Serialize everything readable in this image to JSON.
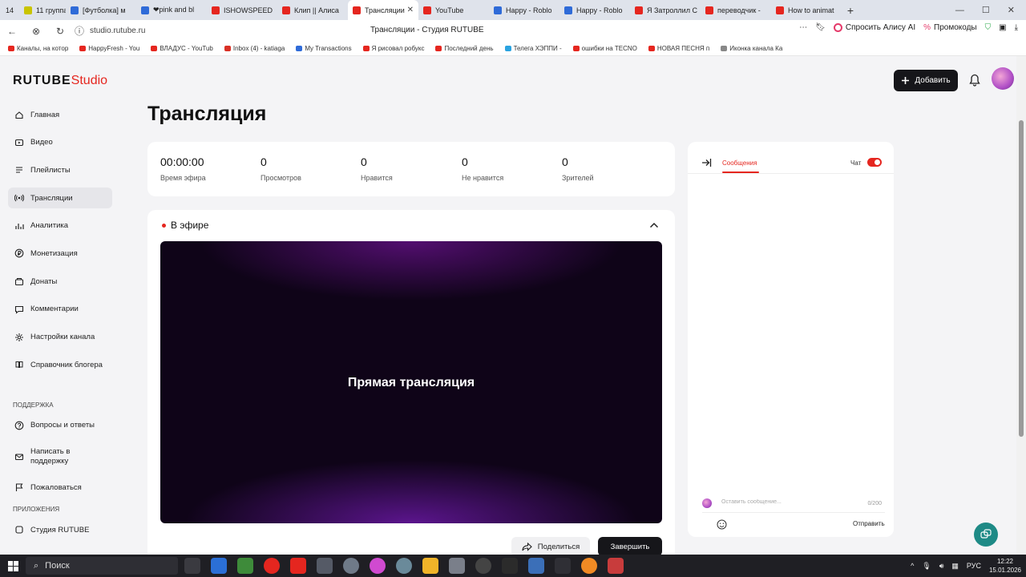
{
  "browser": {
    "tabs": [
      {
        "label": "14",
        "color": "#ffffff",
        "kind": "first"
      },
      {
        "label": "11 группа 1",
        "color": "#c9c400",
        "kind": "group"
      },
      {
        "label": "[Футболка] м",
        "color": "#2f6bd8"
      },
      {
        "label": "❤pink and bl",
        "color": "#2f6bd8"
      },
      {
        "label": "ISHOWSPEED",
        "color": "#e5261f"
      },
      {
        "label": "Клип || Алиса",
        "color": "#e5261f"
      },
      {
        "label": "Трансляции",
        "color": "#e5261f",
        "active": true,
        "close": "✕"
      },
      {
        "label": "YouTube",
        "color": "#e5261f"
      },
      {
        "label": "Happy - Roblo",
        "color": "#2f6bd8"
      },
      {
        "label": "Happy - Roblo",
        "color": "#2f6bd8"
      },
      {
        "label": "Я Затроллил С",
        "color": "#e5261f"
      },
      {
        "label": "переводчик -",
        "color": "#e5261f"
      },
      {
        "label": "How to animat",
        "color": "#e5261f"
      }
    ],
    "url": "studio.rutube.ru",
    "page_title": "Трансляции - Студия RUTUBE",
    "alisa_label": "Спросить Алису AI",
    "promo_label": "Промокоды",
    "bookmarks": [
      {
        "label": "Каналы, на котор",
        "color": "#e5261f"
      },
      {
        "label": "HappyFresh - You",
        "color": "#e5261f"
      },
      {
        "label": "ВЛАДУС - YouTub",
        "color": "#e5261f"
      },
      {
        "label": "Inbox (4) - katiaga",
        "color": "#d93025"
      },
      {
        "label": "My Transactions",
        "color": "#2f6bd8"
      },
      {
        "label": "Я рисовал робукс",
        "color": "#e5261f"
      },
      {
        "label": "Последний день",
        "color": "#e5261f"
      },
      {
        "label": "Телега ХЭППИ -",
        "color": "#2aa3e0"
      },
      {
        "label": "ошибки на TECNO",
        "color": "#e5261f"
      },
      {
        "label": "НОВАЯ ПЕСНЯ п",
        "color": "#e5261f"
      },
      {
        "label": "Иконка канала Ка",
        "color": "#888888"
      }
    ]
  },
  "app": {
    "logo_main": "RUTUBE",
    "logo_studio": "Studio",
    "add_label": "Добавить",
    "page_title": "Трансляция",
    "sidebar": {
      "items": [
        {
          "label": "Главная",
          "icon": "home-icon"
        },
        {
          "label": "Видео",
          "icon": "video-icon"
        },
        {
          "label": "Плейлисты",
          "icon": "playlist-icon"
        },
        {
          "label": "Трансляции",
          "icon": "broadcast-icon",
          "active": true
        },
        {
          "label": "Аналитика",
          "icon": "analytics-icon"
        },
        {
          "label": "Монетизация",
          "icon": "monetization-icon"
        },
        {
          "label": "Донаты",
          "icon": "donate-icon"
        },
        {
          "label": "Комментарии",
          "icon": "comments-icon"
        },
        {
          "label": "Настройки канала",
          "icon": "gear-icon"
        },
        {
          "label": "Справочник блогера",
          "icon": "book-icon"
        }
      ],
      "support_heading": "ПОДДЕРЖКА",
      "support_items": [
        {
          "label": "Вопросы и ответы",
          "icon": "question-icon"
        },
        {
          "label": "Написать в поддержку",
          "icon": "mail-icon"
        },
        {
          "label": "Пожаловаться",
          "icon": "flag-icon"
        }
      ],
      "apps_heading": "ПРИЛОЖЕНИЯ",
      "apps_items": [
        {
          "label": "Студия RUTUBE",
          "icon": "app-icon"
        }
      ]
    },
    "stats": [
      {
        "value": "00:00:00",
        "label": "Время эфира"
      },
      {
        "value": "0",
        "label": "Просмотров"
      },
      {
        "value": "0",
        "label": "Нравится"
      },
      {
        "value": "0",
        "label": "Не нравится"
      },
      {
        "value": "0",
        "label": "Зрителей"
      }
    ],
    "live": {
      "status": "В эфире",
      "player_text": "Прямая трансляция",
      "share_label": "Поделиться",
      "end_label": "Завершить"
    },
    "chat": {
      "tab_label": "Сообщения",
      "toggle_label": "Чат",
      "toggle_on": true,
      "input_placeholder": "Оставить сообщение...",
      "counter": "0/200",
      "send_label": "Отправить"
    },
    "accent_color": "#e5261f"
  },
  "taskbar": {
    "search_label": "Поиск",
    "lang": "РУС",
    "time": "12:22",
    "date": "15.01.2026"
  }
}
